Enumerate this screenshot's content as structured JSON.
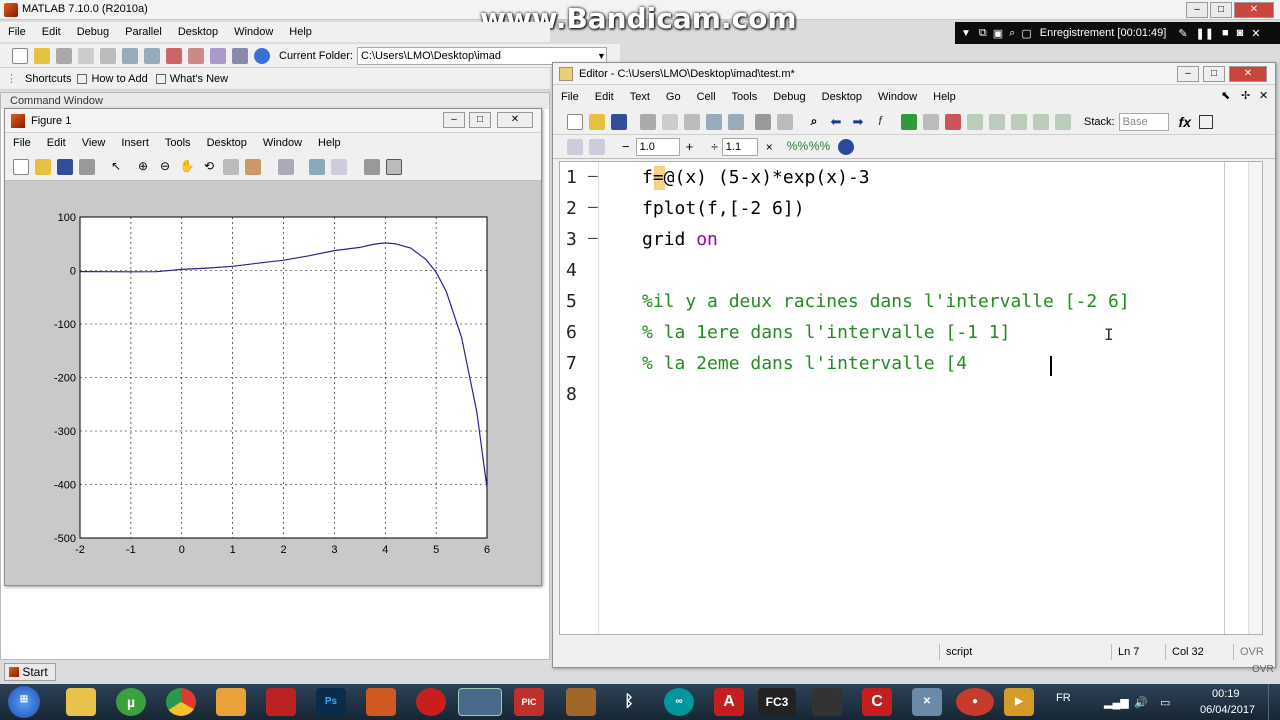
{
  "app": {
    "title": "MATLAB  7.10.0 (R2010a)"
  },
  "watermark": "www.Bandicam.com",
  "recording": {
    "label": "Enregistrement [00:01:49]"
  },
  "menu": [
    "File",
    "Edit",
    "Debug",
    "Parallel",
    "Desktop",
    "Window",
    "Help"
  ],
  "toolbar": {
    "folder_label": "Current Folder:",
    "folder_value": "C:\\Users\\LMO\\Desktop\\imad"
  },
  "shortcuts": {
    "shortcuts": "Shortcuts",
    "howto": "How to Add",
    "whatsnew": "What's New"
  },
  "command_window": {
    "title": "Command Window"
  },
  "figure": {
    "title": "Figure 1",
    "menu": [
      "File",
      "Edit",
      "View",
      "Insert",
      "Tools",
      "Desktop",
      "Window",
      "Help"
    ]
  },
  "chart_data": {
    "type": "line",
    "x": [
      -2,
      -1.5,
      -1,
      -0.5,
      0,
      0.5,
      1,
      1.5,
      2,
      2.5,
      3,
      3.5,
      3.8,
      4,
      4.2,
      4.5,
      4.8,
      5,
      5.2,
      5.5,
      5.8,
      6
    ],
    "y": [
      -2.05,
      -2.24,
      -2.45,
      -2.33,
      2.0,
      4.42,
      7.87,
      13.7,
      19.2,
      27.5,
      37.2,
      43.2,
      49.5,
      51.6,
      50.0,
      42.0,
      20.8,
      -3.0,
      -39.5,
      -125.3,
      -264.3,
      -406.4
    ],
    "xlim": [
      -2,
      6
    ],
    "ylim": [
      -500,
      100
    ],
    "xticks": [
      "-2",
      "-1",
      "0",
      "1",
      "2",
      "3",
      "4",
      "5",
      "6"
    ],
    "yticks": [
      "100",
      "0",
      "-100",
      "-200",
      "-300",
      "-400",
      "-500"
    ],
    "grid": true,
    "color": "#3a1a8c"
  },
  "editor": {
    "title": "Editor - C:\\Users\\LMO\\Desktop\\imad\\test.m*",
    "menu": [
      "File",
      "Edit",
      "Text",
      "Go",
      "Cell",
      "Tools",
      "Debug",
      "Desktop",
      "Window",
      "Help"
    ],
    "stack_label": "Stack:",
    "stack_value": "Base",
    "cell_minus": "−",
    "cell_value1": "1.0",
    "cell_plus": "+",
    "cell_div": "÷",
    "cell_value2": "1.1",
    "cell_times": "×",
    "lines": [
      {
        "num": "1",
        "dash": true
      },
      {
        "num": "2",
        "dash": true
      },
      {
        "num": "3",
        "dash": true
      },
      {
        "num": "4",
        "dash": false
      },
      {
        "num": "5",
        "dash": false
      },
      {
        "num": "6",
        "dash": false
      },
      {
        "num": "7",
        "dash": false
      },
      {
        "num": "8",
        "dash": false
      }
    ],
    "code": {
      "l1": "f=@(x) (5-x)*exp(x)-3",
      "l2": "fplot(f,[-2 6])",
      "l3a": "grid ",
      "l3b": "on",
      "l5": "%il y a deux racines dans l'intervalle [-2 6]",
      "l6": "% la 1ere dans l'intervalle [-1 1]",
      "l7": "% la 2eme dans l'intervalle [4 "
    },
    "status": {
      "mode": "script",
      "ln": "Ln  7",
      "col": "Col  32",
      "ovr": "OVR"
    }
  },
  "start": {
    "label": "Start"
  },
  "taskbar": {
    "lang": "FR",
    "time": "00:19",
    "date": "06/04/2017",
    "apps": [
      "Ps",
      "PIC",
      "FC3"
    ]
  }
}
